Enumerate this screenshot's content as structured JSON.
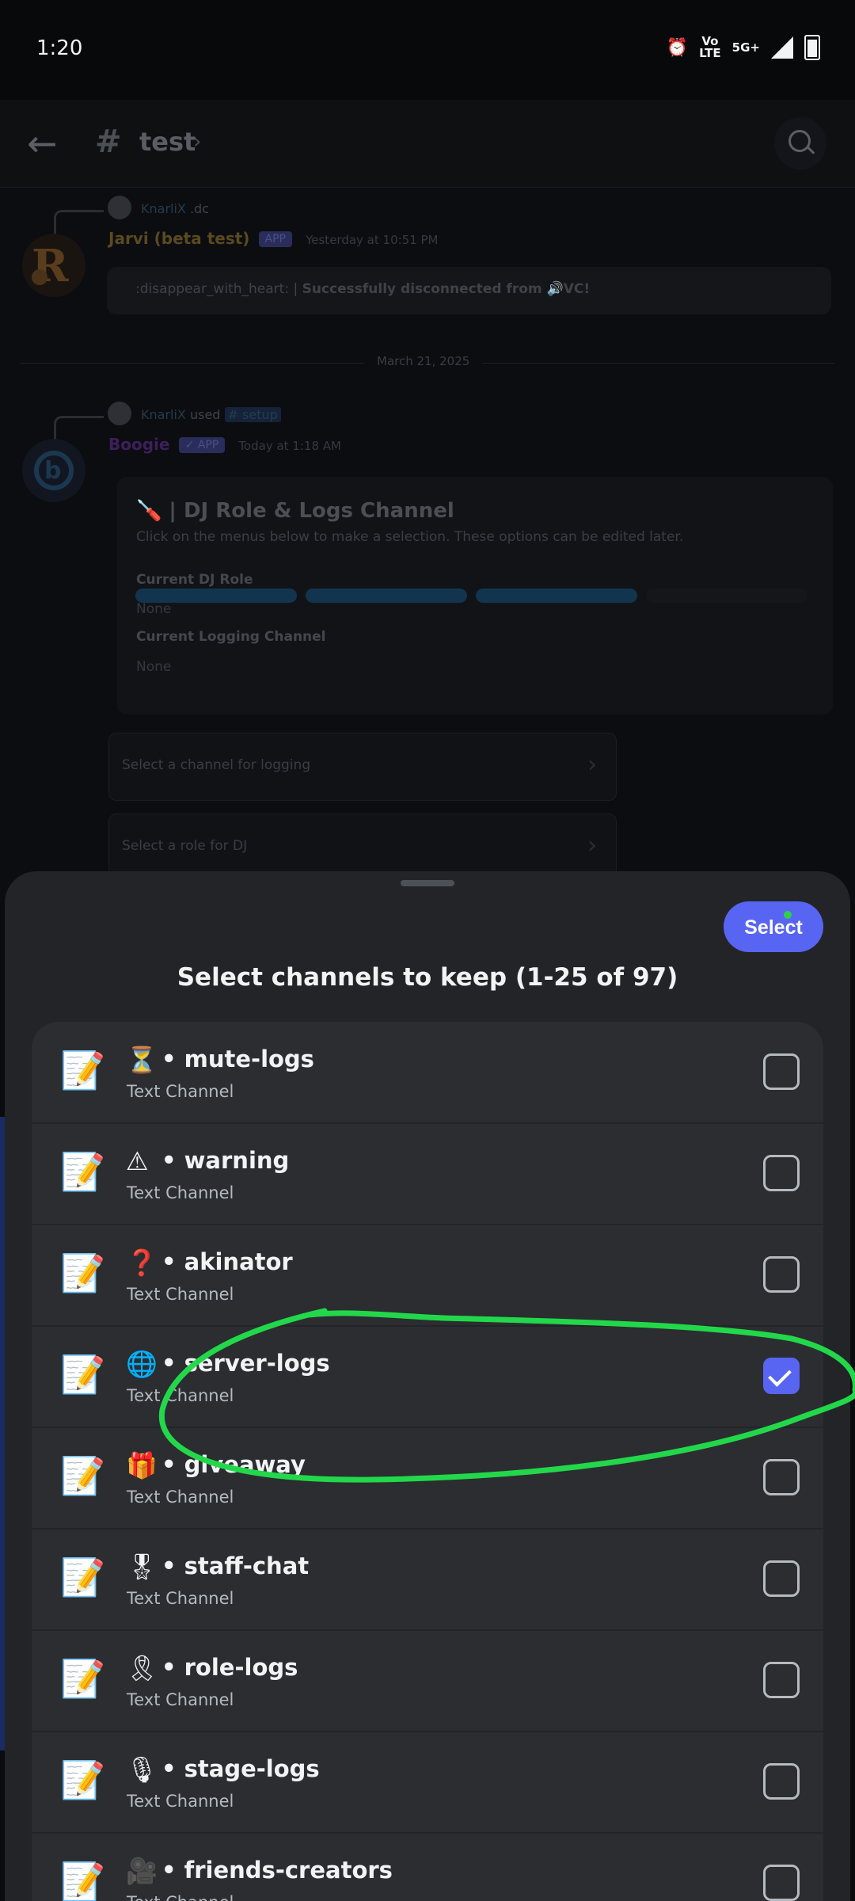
{
  "status_bar": {
    "time": "1:20",
    "network_top": "Vo",
    "network_bottom": "LTE",
    "fiveg": "5G+"
  },
  "header": {
    "title": "test",
    "hash": "#",
    "chevron": "›"
  },
  "chat": {
    "reply1": {
      "user": "KnarliX",
      "suffix": ".dc"
    },
    "msg1": {
      "author": "Jarvi (beta test)",
      "badge": "APP",
      "time": "Yesterday at 10:51 PM",
      "text_prefix": ":disappear_with_heart: | ",
      "text_bold": "Successfully disconnected from 🔊VC!"
    },
    "date_divider": "March 21, 2025",
    "reply2": {
      "user": "KnarliX",
      "used": "used",
      "command": "# setup"
    },
    "msg2": {
      "author": "Boogie",
      "badge": "✓ APP",
      "time": "Today at 1:18 AM"
    },
    "embed": {
      "title": "🪛 | DJ Role & Logs Channel",
      "description": "Click on the menus below to make a selection. These options can be edited later.",
      "field1_name": "Current DJ Role",
      "field1_value": "None",
      "field2_name": "Current Logging Channel",
      "field2_value": "None"
    },
    "select_logging": "Select a channel for logging",
    "select_dj": "Select a role for DJ"
  },
  "sheet": {
    "select_button": "Select",
    "title": "Select channels to keep (1-25 of 97)",
    "channels": [
      {
        "emoji": "⏳",
        "name": "• mute-logs",
        "type": "Text Channel",
        "checked": false
      },
      {
        "emoji": "⚠",
        "name": "• warning",
        "type": "Text Channel",
        "checked": false
      },
      {
        "emoji": "❓",
        "name": "• akinator",
        "type": "Text Channel",
        "checked": false
      },
      {
        "emoji": "🌐",
        "name": "• server-logs",
        "type": "Text Channel",
        "checked": true
      },
      {
        "emoji": "🎁",
        "name": "• giveaway",
        "type": "Text Channel",
        "checked": false
      },
      {
        "emoji": "🎖",
        "name": "• staff-chat",
        "type": "Text Channel",
        "checked": false
      },
      {
        "emoji": "🎗",
        "name": "• role-logs",
        "type": "Text Channel",
        "checked": false
      },
      {
        "emoji": "🎙",
        "name": "• stage-logs",
        "type": "Text Channel",
        "checked": false
      },
      {
        "emoji": "🎥",
        "name": "• friends-creators",
        "type": "Text Channel",
        "checked": false
      }
    ]
  },
  "colors": {
    "accent": "#5865f2",
    "annotation": "#22d84a",
    "sheet_bg": "#232428",
    "list_bg": "#2b2d31"
  },
  "icons": {
    "row_icon": "memo-icon",
    "back": "back-arrow-icon",
    "search": "search-icon"
  }
}
